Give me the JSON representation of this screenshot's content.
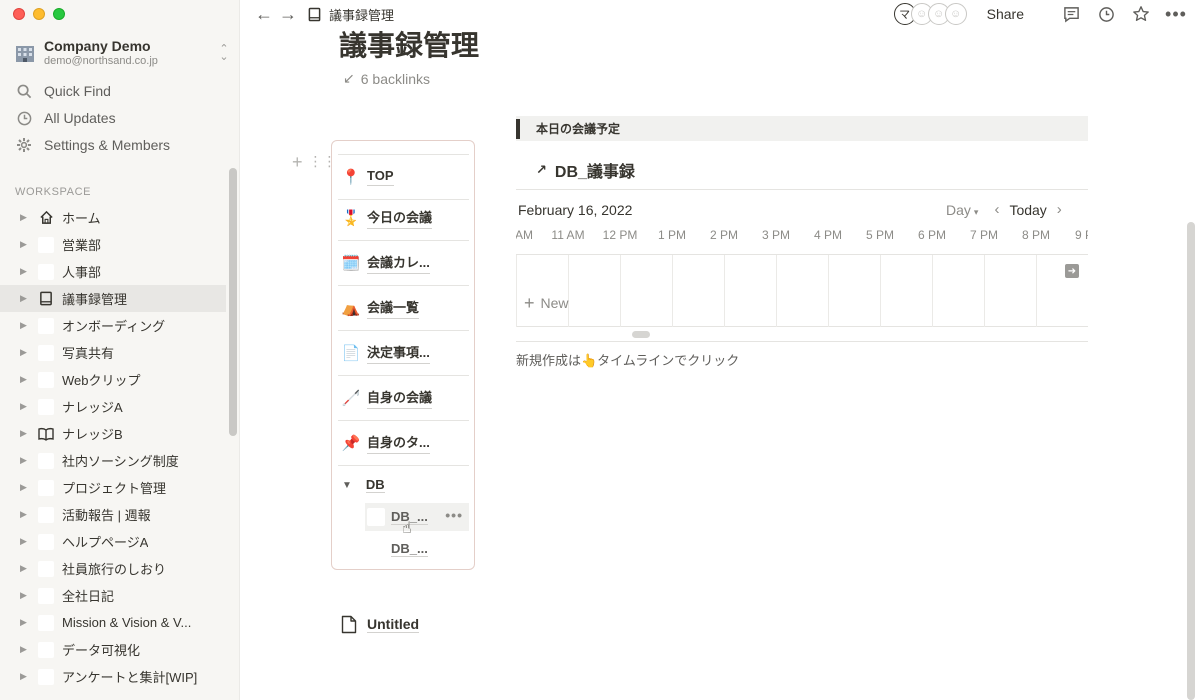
{
  "sidebar": {
    "workspace": {
      "name": "Company Demo",
      "email": "demo@northsand.co.jp"
    },
    "menu": [
      {
        "label": "Quick Find",
        "icon": "search-icon"
      },
      {
        "label": "All Updates",
        "icon": "clock-icon"
      },
      {
        "label": "Settings & Members",
        "icon": "gear-icon"
      }
    ],
    "section_label": "WORKSPACE",
    "pages": [
      {
        "label": "ホーム",
        "icon": "home-icon"
      },
      {
        "label": "営業部",
        "icon": "blank-page-icon"
      },
      {
        "label": "人事部",
        "icon": "blank-page-icon"
      },
      {
        "label": "議事録管理",
        "icon": "book-icon",
        "active": true
      },
      {
        "label": "オンボーディング",
        "icon": "blank-page-icon"
      },
      {
        "label": "写真共有",
        "icon": "blank-page-icon"
      },
      {
        "label": "Webクリップ",
        "icon": "blank-page-icon"
      },
      {
        "label": "ナレッジA",
        "icon": "blank-page-icon"
      },
      {
        "label": "ナレッジB",
        "icon": "open-book-icon"
      },
      {
        "label": "社内ソーシング制度",
        "icon": "blank-page-icon"
      },
      {
        "label": "プロジェクト管理",
        "icon": "blank-page-icon"
      },
      {
        "label": "活動報告 | 週報",
        "icon": "blank-page-icon"
      },
      {
        "label": "ヘルプページA",
        "icon": "blank-page-icon"
      },
      {
        "label": "社員旅行のしおり",
        "icon": "blank-page-icon"
      },
      {
        "label": "全社日記",
        "icon": "blank-page-icon"
      },
      {
        "label": "Mission & Vision & V...",
        "icon": "blank-page-icon"
      },
      {
        "label": "データ可視化",
        "icon": "blank-page-icon"
      },
      {
        "label": "アンケートと集計[WIP]",
        "icon": "blank-page-icon"
      }
    ]
  },
  "topbar": {
    "breadcrumb": "議事録管理",
    "share_label": "Share",
    "avatars": [
      "マ",
      "",
      "",
      ""
    ]
  },
  "page": {
    "title": "議事録管理",
    "backlinks": "6 backlinks",
    "toc": {
      "entries": [
        {
          "emoji": "📍",
          "label": "TOP"
        },
        {
          "emoji": "🎖️",
          "label": "今日の会議"
        },
        {
          "emoji": "🗓️",
          "label": "会議カレ..."
        },
        {
          "emoji": "⛺",
          "label": "会議一覧"
        },
        {
          "emoji": "📄",
          "label": "決定事項..."
        },
        {
          "emoji": "🦯",
          "label": "自身の会議"
        },
        {
          "emoji": "📌",
          "label": "自身のタ..."
        }
      ],
      "db_label": "DB",
      "db_children": [
        "DB_...",
        "DB_..."
      ]
    },
    "callout": "本日の会議予定",
    "database": {
      "title": "DB_議事録",
      "date": "February 16, 2022",
      "view": "Day",
      "today_label": "Today",
      "hours": [
        "AM",
        "11 AM",
        "12 PM",
        "1 PM",
        "2 PM",
        "3 PM",
        "4 PM",
        "5 PM",
        "6 PM",
        "7 PM",
        "8 PM",
        "9 P"
      ],
      "new_label": "New",
      "note": "新規作成は👆タイムラインでクリック"
    },
    "untitled": "Untitled"
  }
}
